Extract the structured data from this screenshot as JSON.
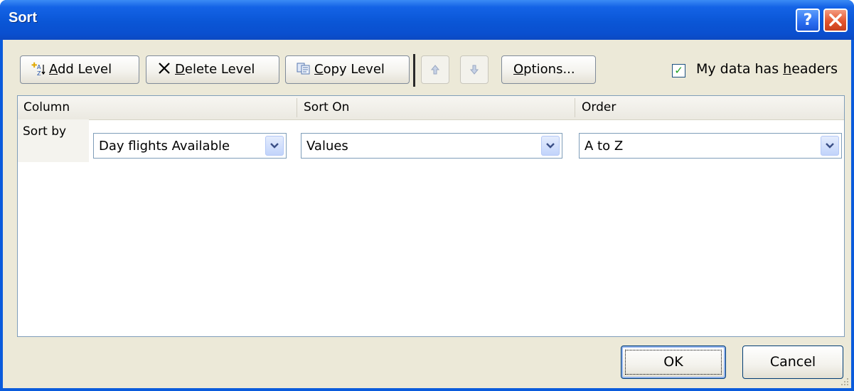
{
  "dialog": {
    "title": "Sort"
  },
  "toolbar": {
    "add_level": "Add Level",
    "delete_level": "Delete Level",
    "copy_level": "Copy Level",
    "options": "Options...",
    "move_up_icon": "arrow-up-icon",
    "move_down_icon": "arrow-down-icon"
  },
  "headers_checkbox": {
    "label": "My data has headers",
    "checked": true
  },
  "grid": {
    "columns": [
      "Column",
      "Sort On",
      "Order"
    ],
    "rows": [
      {
        "label": "Sort by",
        "column": "Day flights Available",
        "sort_on": "Values",
        "order": "A to Z"
      }
    ]
  },
  "footer": {
    "ok": "OK",
    "cancel": "Cancel"
  },
  "colors": {
    "title_bar": "#0a56d6",
    "client_bg": "#ece9d8",
    "check": "#21a121",
    "close": "#e4552e"
  }
}
